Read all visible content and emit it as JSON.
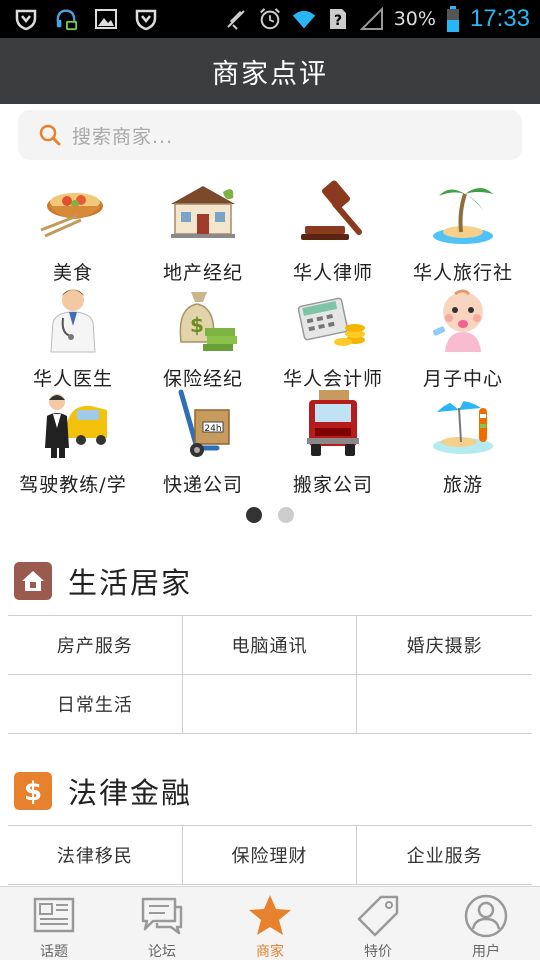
{
  "status_bar": {
    "battery": "30%",
    "time": "17:33",
    "icons": [
      "shield-icon",
      "headset-icon",
      "image-icon",
      "shield-icon",
      "mute-icon",
      "alarm-icon",
      "wifi-icon",
      "sim-unknown-icon",
      "signal-icon",
      "battery-icon"
    ]
  },
  "header": {
    "title": "商家点评"
  },
  "search": {
    "placeholder": "搜索商家..."
  },
  "categories": [
    {
      "label": "美食",
      "icon": "food-bowl-icon"
    },
    {
      "label": "地产经纪",
      "icon": "house-icon"
    },
    {
      "label": "华人律师",
      "icon": "gavel-icon"
    },
    {
      "label": "华人旅行社",
      "icon": "palm-island-icon"
    },
    {
      "label": "华人医生",
      "icon": "doctor-icon"
    },
    {
      "label": "保险经纪",
      "icon": "money-bag-icon"
    },
    {
      "label": "华人会计师",
      "icon": "calculator-coins-icon"
    },
    {
      "label": "月子中心",
      "icon": "baby-icon"
    },
    {
      "label": "驾驶教练/学",
      "icon": "taxi-driver-icon"
    },
    {
      "label": "快递公司",
      "icon": "hand-truck-icon"
    },
    {
      "label": "搬家公司",
      "icon": "moving-truck-icon"
    },
    {
      "label": "旅游",
      "icon": "beach-umbrella-icon"
    }
  ],
  "pager": {
    "pages": 2,
    "active": 1
  },
  "sections": [
    {
      "title": "生活居家",
      "icon": "home-icon",
      "color": "#9b5a4e",
      "rows": [
        [
          "房产服务",
          "电脑通讯",
          "婚庆摄影"
        ],
        [
          "日常生活",
          "",
          ""
        ]
      ]
    },
    {
      "title": "法律金融",
      "icon": "dollar-icon",
      "color": "#e8812e",
      "rows": [
        [
          "法律移民",
          "保险理财",
          "企业服务"
        ]
      ]
    }
  ],
  "tabs": [
    {
      "label": "话题",
      "icon": "newspaper-icon",
      "active": false
    },
    {
      "label": "论坛",
      "icon": "chat-bubbles-icon",
      "active": false
    },
    {
      "label": "商家",
      "icon": "star-icon",
      "active": true
    },
    {
      "label": "特价",
      "icon": "price-tag-icon",
      "active": false
    },
    {
      "label": "用户",
      "icon": "user-icon",
      "active": false
    }
  ],
  "colors": {
    "accent": "#e8812e",
    "titlebar": "#3b3d3f",
    "time": "#29b6f6"
  }
}
